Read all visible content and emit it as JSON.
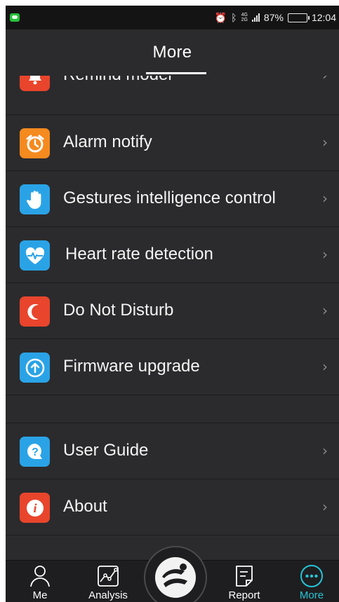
{
  "status_bar": {
    "battery_percent": "87%",
    "time": "12:04",
    "net_top": "4G",
    "net_bottom": "2G"
  },
  "header": {
    "title": "More"
  },
  "menu": {
    "items": [
      {
        "label": "Remind model",
        "icon": "bell-icon",
        "color": "#e8452c"
      },
      {
        "label": "Alarm notify",
        "icon": "alarm-clock-icon",
        "color": "#f58a1f"
      },
      {
        "label": "Gestures intelligence control",
        "icon": "hand-icon",
        "color": "#2aa3e6"
      },
      {
        "label": "Heart rate detection",
        "icon": "heart-rate-icon",
        "color": "#2aa3e6"
      },
      {
        "label": "Do Not Disturb",
        "icon": "moon-icon",
        "color": "#e8452c"
      },
      {
        "label": "Firmware upgrade",
        "icon": "upgrade-arrow-icon",
        "color": "#2aa3e6"
      }
    ],
    "items2": [
      {
        "label": "User Guide",
        "icon": "question-icon",
        "color": "#2aa3e6"
      },
      {
        "label": "About",
        "icon": "info-icon",
        "color": "#e8452c"
      }
    ],
    "chevron": "›"
  },
  "tabs": [
    {
      "label": "Me",
      "icon": "person-icon",
      "active": false
    },
    {
      "label": "Analysis",
      "icon": "chart-icon",
      "active": false
    },
    {
      "label": "Report",
      "icon": "report-icon",
      "active": false
    },
    {
      "label": "More",
      "icon": "more-dots-icon",
      "active": true
    }
  ],
  "colors": {
    "accent": "#26c4d6",
    "background": "#2b2b2d",
    "tabbar": "#1e1e20"
  }
}
